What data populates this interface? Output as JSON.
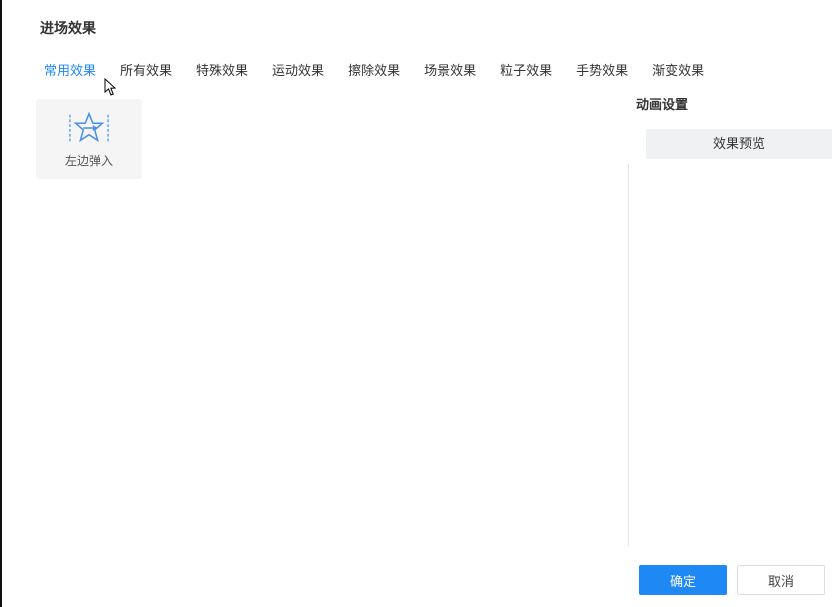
{
  "header": {
    "title": "进场效果"
  },
  "tabs": {
    "items": [
      {
        "label": "常用效果",
        "active": true
      },
      {
        "label": "所有效果",
        "active": false
      },
      {
        "label": "特殊效果",
        "active": false
      },
      {
        "label": "运动效果",
        "active": false
      },
      {
        "label": "擦除效果",
        "active": false
      },
      {
        "label": "场景效果",
        "active": false
      },
      {
        "label": "粒子效果",
        "active": false
      },
      {
        "label": "手势效果",
        "active": false
      },
      {
        "label": "渐变效果",
        "active": false
      }
    ]
  },
  "effects": {
    "items": [
      {
        "label": "左边弹入",
        "icon": "star-arrow-right"
      }
    ]
  },
  "rightPanel": {
    "title": "动画设置",
    "previewHeader": "效果预览"
  },
  "footer": {
    "ok": "确定",
    "cancel": "取消"
  }
}
